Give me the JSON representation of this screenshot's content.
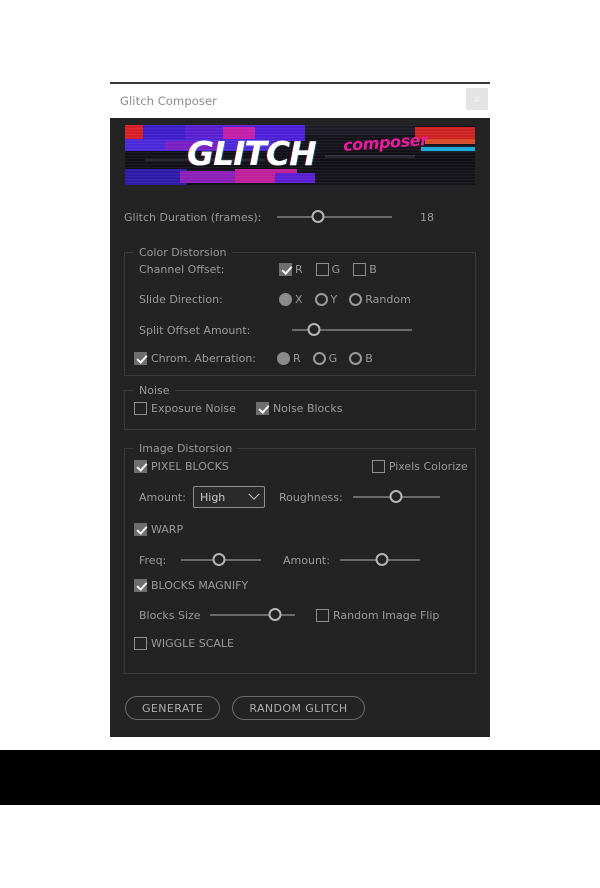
{
  "window": {
    "title": "Glitch Composer",
    "close_label": "x"
  },
  "banner": {
    "title": "GLITCH",
    "subtitle": "composer"
  },
  "duration": {
    "label": "Glitch Duration (frames):",
    "value": "18",
    "slider_percent": 36
  },
  "color_distorsion": {
    "legend": "Color Distorsion",
    "channel_offset": {
      "label": "Channel Offset:",
      "options": [
        {
          "label": "R",
          "checked": true
        },
        {
          "label": "G",
          "checked": false
        },
        {
          "label": "B",
          "checked": false
        }
      ]
    },
    "slide_direction": {
      "label": "Slide Direction:",
      "options": [
        {
          "label": "X",
          "selected": true
        },
        {
          "label": "Y",
          "selected": false
        },
        {
          "label": "Random",
          "selected": false
        }
      ]
    },
    "split_offset": {
      "label": "Split Offset Amount:",
      "slider_percent": 18
    },
    "chrom_aberration": {
      "label": "Chrom. Aberration:",
      "checked": true,
      "options": [
        {
          "label": "R",
          "selected": true
        },
        {
          "label": "G",
          "selected": false
        },
        {
          "label": "B",
          "selected": false
        }
      ]
    }
  },
  "noise": {
    "legend": "Noise",
    "options": [
      {
        "label": "Exposure Noise",
        "checked": false
      },
      {
        "label": "Noise Blocks",
        "checked": true
      }
    ]
  },
  "image_distorsion": {
    "legend": "Image Distorsion",
    "pixel_blocks": {
      "label": "PIXEL BLOCKS",
      "checked": true
    },
    "pixels_colorize": {
      "label": "Pixels Colorize",
      "checked": false
    },
    "amount": {
      "label": "Amount:",
      "value": "High"
    },
    "roughness": {
      "label": "Roughness:",
      "slider_percent": 50
    },
    "warp": {
      "label": "WARP",
      "checked": true
    },
    "freq": {
      "label": "Freq:",
      "slider_percent": 47
    },
    "warp_amount": {
      "label": "Amount:",
      "slider_percent": 53
    },
    "blocks_magnify": {
      "label": "BLOCKS MAGNIFY",
      "checked": true
    },
    "blocks_size": {
      "label": "Blocks Size",
      "slider_percent": 76
    },
    "random_image_flip": {
      "label": "Random Image Flip",
      "checked": false
    },
    "wiggle_scale": {
      "label": "WIGGLE SCALE",
      "checked": false
    }
  },
  "actions": {
    "generate": "GENERATE",
    "random_glitch": "RANDOM GLITCH"
  }
}
